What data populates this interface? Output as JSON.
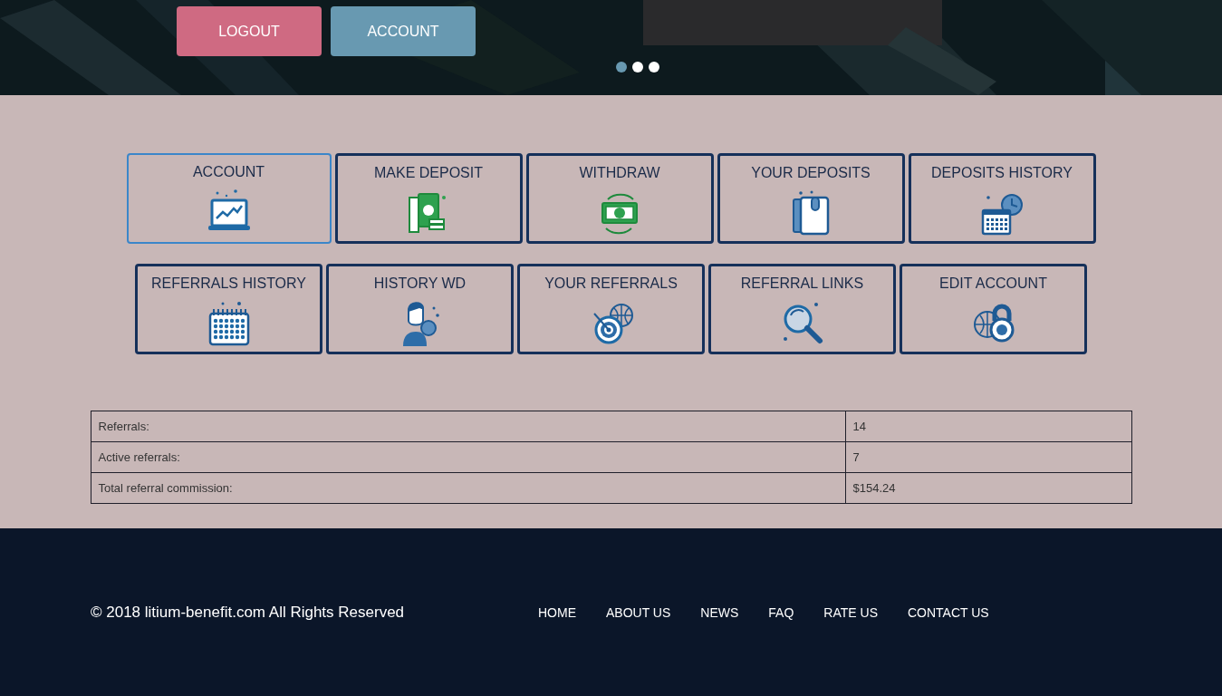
{
  "header": {
    "buttons": [
      {
        "label": "LOGOUT",
        "kind": "logout"
      },
      {
        "label": "ACCOUNT",
        "kind": "account"
      }
    ],
    "slider_dots": [
      {
        "selected": true
      },
      {
        "selected": false
      },
      {
        "selected": false
      }
    ]
  },
  "menu_rows": [
    [
      {
        "label": "ACCOUNT",
        "kind": "laptop-chart",
        "selected": true
      },
      {
        "label": "MAKE DEPOSIT",
        "kind": "cash-coins",
        "selected": false
      },
      {
        "label": "WITHDRAW",
        "kind": "cash-cycle",
        "selected": false
      },
      {
        "label": "YOUR DEPOSITS",
        "kind": "wallet",
        "selected": false
      },
      {
        "label": "DEPOSITS HISTORY",
        "kind": "calendar-clock",
        "selected": false
      }
    ],
    [
      {
        "label": "REFERRALS HISTORY",
        "kind": "calendar",
        "selected": false
      },
      {
        "label": "HISTORY WD",
        "kind": "person-coin",
        "selected": false
      },
      {
        "label": "YOUR REFERRALS",
        "kind": "target-globe",
        "selected": false
      },
      {
        "label": "REFERRAL LINKS",
        "kind": "magnifier",
        "selected": false
      },
      {
        "label": "EDIT ACCOUNT",
        "kind": "globe-lock",
        "selected": false
      }
    ]
  ],
  "stats": [
    {
      "label": "Referrals:",
      "value": "14"
    },
    {
      "label": "Active referrals:",
      "value": "7"
    },
    {
      "label": "Total referral commission:",
      "value": "$154.24"
    }
  ],
  "footer": {
    "copyright": "© 2018 litium-benefit.com All Rights Reserved",
    "links": [
      "HOME",
      "ABOUT US",
      "NEWS",
      "FAQ",
      "RATE US",
      "CONTACT US"
    ]
  }
}
